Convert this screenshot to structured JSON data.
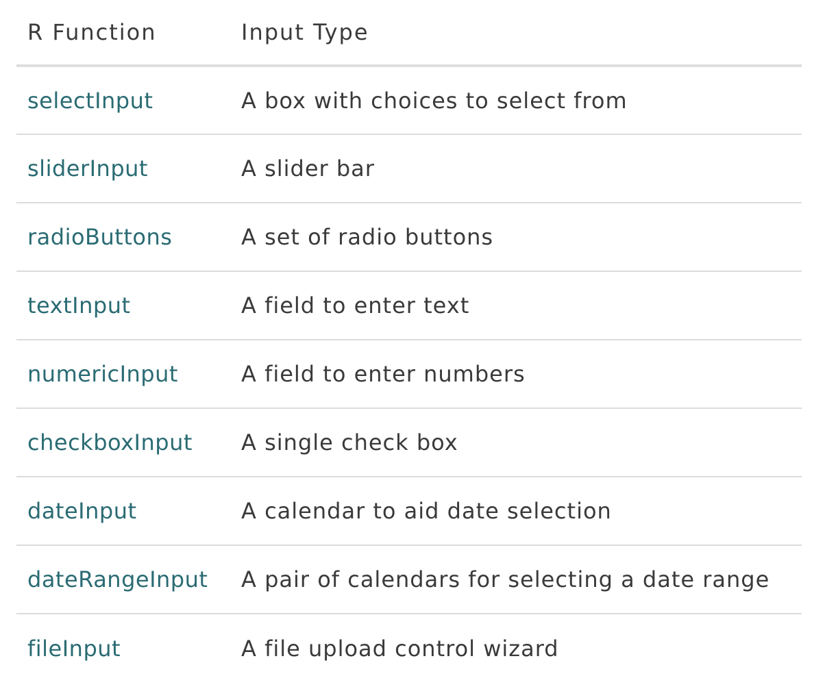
{
  "table": {
    "headers": {
      "function": "R Function",
      "input_type": "Input Type"
    },
    "rows": [
      {
        "function": "selectInput",
        "input_type": "A box with choices to select from"
      },
      {
        "function": "sliderInput",
        "input_type": "A slider bar"
      },
      {
        "function": "radioButtons",
        "input_type": "A set of radio buttons"
      },
      {
        "function": "textInput",
        "input_type": "A field to enter text"
      },
      {
        "function": "numericInput",
        "input_type": "A field to enter numbers"
      },
      {
        "function": "checkboxInput",
        "input_type": "A single check box"
      },
      {
        "function": "dateInput",
        "input_type": "A calendar to aid date selection"
      },
      {
        "function": "dateRangeInput",
        "input_type": "A pair of calendars for selecting a date range"
      },
      {
        "function": "fileInput",
        "input_type": "A file upload control wizard"
      }
    ]
  },
  "colors": {
    "function_text": "#2a6b73",
    "body_text": "#3a3a3a",
    "header_rule": "#dedede",
    "row_rule": "#dcdcdc"
  }
}
